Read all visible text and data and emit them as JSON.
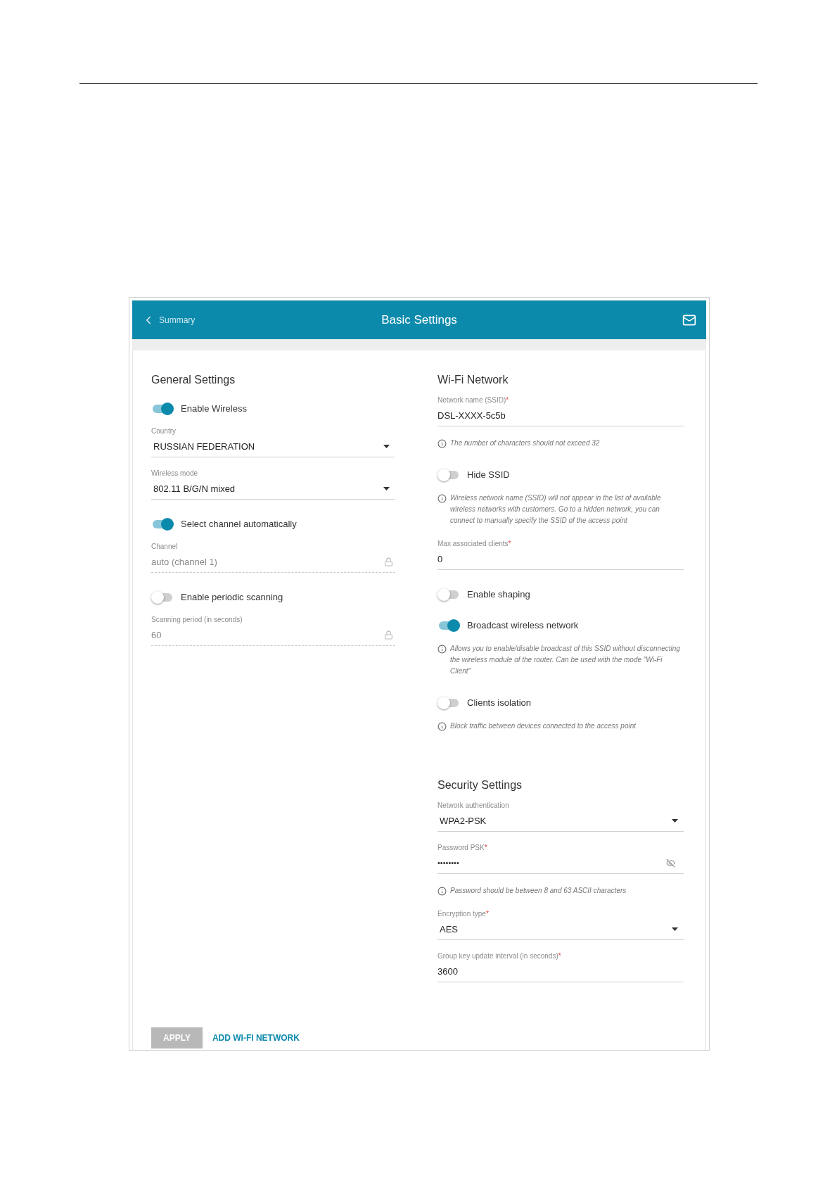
{
  "header": {
    "back_label": "Summary",
    "title": "Basic Settings"
  },
  "columns": [
    {
      "sections": [
        {
          "title": "General Settings",
          "items": [
            {
              "kind": "toggle",
              "label": "Enable Wireless",
              "on": true
            },
            {
              "kind": "select",
              "label": "Country",
              "value": "RUSSIAN FEDERATION"
            },
            {
              "kind": "select",
              "label": "Wireless mode",
              "value": "802.11 B/G/N mixed"
            },
            {
              "kind": "toggle",
              "label": "Select channel automatically",
              "on": true
            },
            {
              "kind": "locked",
              "label": "Channel",
              "value": "auto (channel 1)"
            },
            {
              "kind": "toggle",
              "label": "Enable periodic scanning",
              "on": false
            },
            {
              "kind": "locked",
              "label": "Scanning period (in seconds)",
              "value": "60"
            }
          ]
        }
      ]
    },
    {
      "sections": [
        {
          "title": "Wi-Fi Network",
          "items": [
            {
              "kind": "field",
              "label": "Network name (SSID)",
              "mark": "*",
              "value": "DSL-XXXX-5c5b"
            },
            {
              "kind": "hint",
              "text": "The number of characters should not exceed 32"
            },
            {
              "kind": "toggle",
              "label": "Hide SSID",
              "on": false
            },
            {
              "kind": "hint",
              "text": "Wireless network name (SSID) will not appear in the list of available wireless networks with customers. Go to a hidden network, you can connect to manually specify the SSID of the access point"
            },
            {
              "kind": "field",
              "label": "Max associated clients",
              "mark": "*",
              "value": "0"
            },
            {
              "kind": "toggle",
              "label": "Enable shaping",
              "on": false
            },
            {
              "kind": "toggle",
              "label": "Broadcast wireless network",
              "on": true
            },
            {
              "kind": "hint",
              "text": "Allows you to enable/disable broadcast of this SSID without disconnecting the wireless module of the router. Can be used with the mode \"Wi-Fi Client\""
            },
            {
              "kind": "toggle",
              "label": "Clients isolation",
              "on": false
            },
            {
              "kind": "hint",
              "text": "Block traffic between devices connected to the access point"
            }
          ]
        },
        {
          "title": "Security Settings",
          "items": [
            {
              "kind": "select",
              "label": "Network authentication",
              "value": "WPA2-PSK"
            },
            {
              "kind": "password",
              "label": "Password PSK",
              "mark": "*",
              "value": "••••••••",
              "visible": false
            },
            {
              "kind": "hint",
              "text": "Password should be between 8 and 63 ASCII characters"
            },
            {
              "kind": "select",
              "label": "Encryption type",
              "mark": "*",
              "value": "AES"
            },
            {
              "kind": "field",
              "label": "Group key update interval (in seconds)",
              "mark": "*",
              "value": "3600"
            }
          ]
        }
      ]
    }
  ],
  "buttons": [
    {
      "kind": "primary",
      "label": "APPLY",
      "disabled": true
    },
    {
      "kind": "link",
      "label": "ADD WI-FI NETWORK",
      "disabled": false
    }
  ]
}
